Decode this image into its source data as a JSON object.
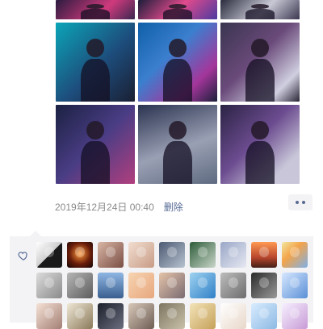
{
  "post": {
    "timestamp": "2019年12月24日 00:40",
    "delete_label": "删除",
    "more_icon": "more-dots-icon"
  },
  "photos": [
    {
      "bg": "linear-gradient(135deg,#2b1b3f,#d03a7d 60%,#3a2750)"
    },
    {
      "bg": "linear-gradient(135deg,#1c1d3a,#e04a8c 50%,#4b3aa0)"
    },
    {
      "bg": "linear-gradient(135deg,#2a2c3d,#c9c9d6 55%,#3b3750)"
    },
    {
      "bg": "linear-gradient(135deg,#0ba5b8,#1d4d7c 55%,#1a1f33)"
    },
    {
      "bg": "linear-gradient(135deg,#0f5fa8,#3b7fcf 40%,#a4369b 75%,#1b1f3a)"
    },
    {
      "bg": "linear-gradient(135deg,#3a3550,#6a4a7a 45%,#d0cfe0 80%,#2a2535)"
    },
    {
      "bg": "linear-gradient(135deg,#1b2142,#4a3d85 50%,#b23f7e)"
    },
    {
      "bg": "linear-gradient(160deg,#2a3350,#9aa0b4 55%,#5e6a80)"
    },
    {
      "bg": "linear-gradient(135deg,#2b2344,#6c4c90 45%,#c8c6d8 80%)"
    }
  ],
  "likes": {
    "heart_icon": "heart-icon",
    "avatars": [
      {
        "bg": "linear-gradient(135deg,#ffffff,#cfcfcf 50%,#1a1a1a 51%)"
      },
      {
        "bg": "radial-gradient(circle at 50% 45%,#ff9a3c,#6a1d0a 55%,#140606)"
      },
      {
        "bg": "linear-gradient(135deg,#d8b6a5,#7a4e44)"
      },
      {
        "bg": "linear-gradient(135deg,#f1ddd0,#c89c86)"
      },
      {
        "bg": "linear-gradient(135deg,#4c5a73,#b7c2cf)"
      },
      {
        "bg": "linear-gradient(135deg,#2e5d3a,#c9d6c9)"
      },
      {
        "bg": "linear-gradient(135deg,#9aa7c7,#e6e8f2)"
      },
      {
        "bg": "linear-gradient(180deg,#ff9a52,#b8462d 60%,#432018)"
      },
      {
        "bg": "linear-gradient(135deg,#f2e7a0,#f3a44a 40%,#7fb0e6)"
      },
      {
        "bg": "linear-gradient(135deg,#dcdcdc,#8a8a8a)"
      },
      {
        "bg": "linear-gradient(135deg,#b6b6b6,#5c5c5c)"
      },
      {
        "bg": "linear-gradient(180deg,#8fb6e3,#3a5f8f)"
      },
      {
        "bg": "linear-gradient(135deg,#f7d4b1,#e7a77e)"
      },
      {
        "bg": "linear-gradient(135deg,#e4c3a8,#7a6a72)"
      },
      {
        "bg": "linear-gradient(135deg,#9ed2f0,#2f80c7)"
      },
      {
        "bg": "linear-gradient(135deg,#bcbcbc,#6d6d6d)"
      },
      {
        "bg": "linear-gradient(135deg,#2a2a2a,#9a9a9a)"
      },
      {
        "bg": "linear-gradient(135deg,#d7e8ff,#5a8fd6)"
      },
      {
        "bg": "linear-gradient(135deg,#f5e1d6,#a37f74)"
      },
      {
        "bg": "linear-gradient(135deg,#efe7d6,#8a7a5a)"
      },
      {
        "bg": "linear-gradient(135deg,#1b1f2a,#6b6f80)"
      },
      {
        "bg": "linear-gradient(135deg,#d9c8b9,#6d5e55)"
      },
      {
        "bg": "linear-gradient(135deg,#7e7560,#c9c2aa)"
      },
      {
        "bg": "linear-gradient(135deg,#f3e3b8,#c5a15a)"
      },
      {
        "bg": "linear-gradient(135deg,#ffffff,#e8d7c9)"
      },
      {
        "bg": "linear-gradient(135deg,#d8ecff,#8db9e3)"
      },
      {
        "bg": "linear-gradient(135deg,#f7f0ff,#c79bd6)"
      }
    ]
  }
}
